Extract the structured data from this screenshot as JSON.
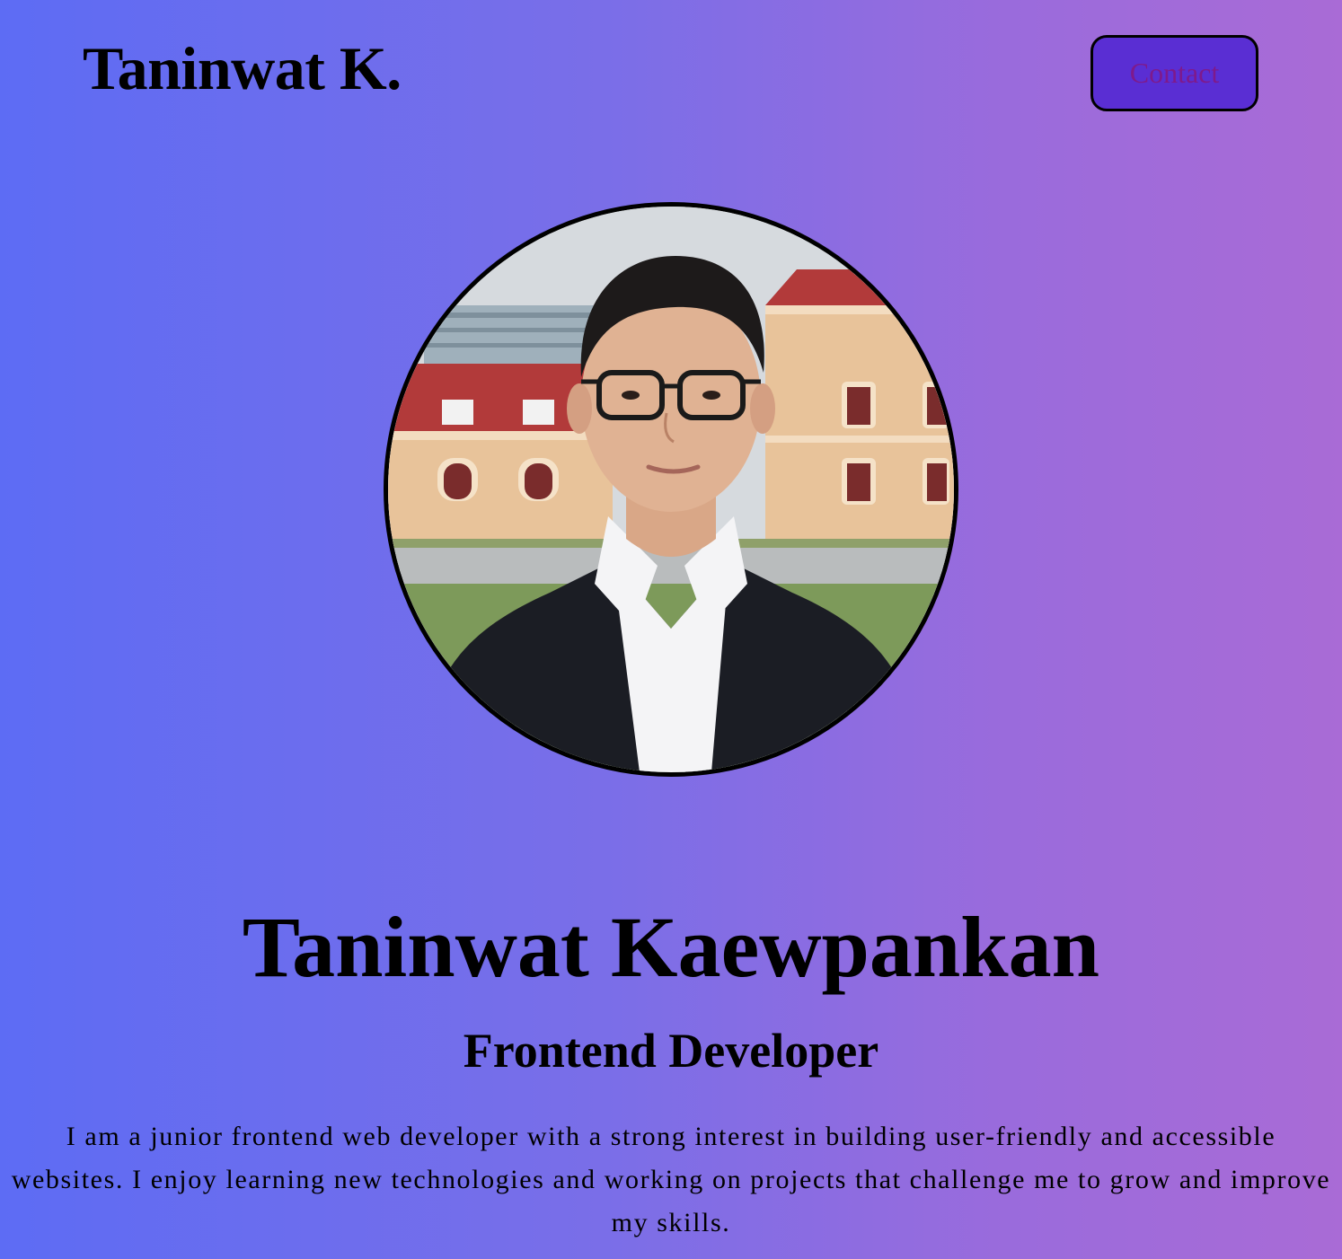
{
  "header": {
    "brand": "Taninwat K.",
    "contact_label": "Contact"
  },
  "profile": {
    "photo_alt": "Taninwat Kaewpankan",
    "name": "Taninwat Kaewpankan",
    "role": "Frontend Developer",
    "bio": "I am a junior frontend web developer with a strong interest in building user-friendly and accessible websites. I enjoy learning new technologies and working on projects that challenge me to grow and improve my skills."
  },
  "colors": {
    "gradient_start": "#5d6cf4",
    "gradient_end": "#a96bd6",
    "button_bg": "#5a2ed3",
    "button_text": "#7e1a8c"
  }
}
